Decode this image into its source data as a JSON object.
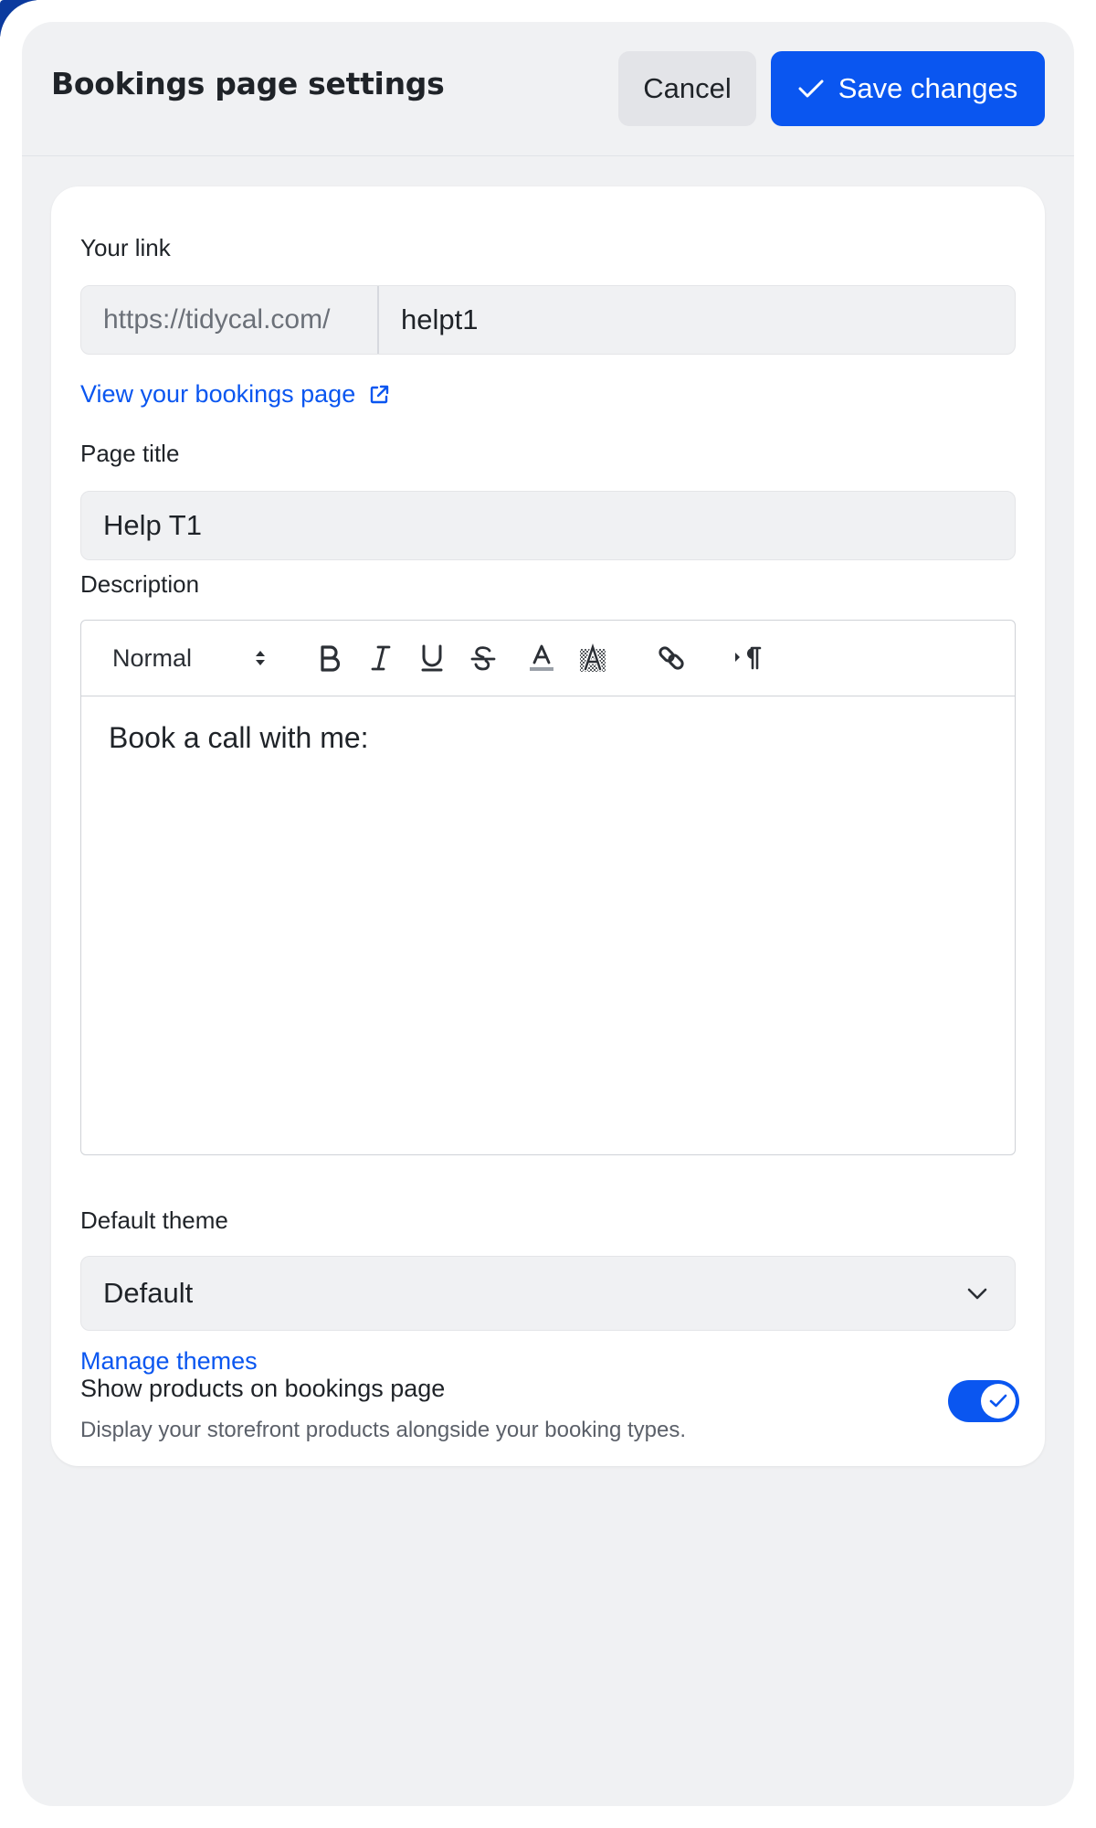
{
  "header": {
    "title": "Bookings page settings",
    "cancel_label": "Cancel",
    "save_label": "Save changes"
  },
  "link_section": {
    "label": "Your link",
    "prefix": "https://tidycal.com/",
    "value": "helpt1",
    "view_link_label": "View your bookings page"
  },
  "page_title_section": {
    "label": "Page title",
    "value": "Help T1"
  },
  "description_section": {
    "label": "Description",
    "toolbar": {
      "format_value": "Normal",
      "tools": [
        "bold-icon",
        "italic-icon",
        "underline-icon",
        "strikethrough-icon",
        "text-color-icon",
        "highlight-color-icon",
        "link-icon",
        "text-direction-icon"
      ]
    },
    "content": "Book a call with me:"
  },
  "theme_section": {
    "label": "Default theme",
    "value": "Default",
    "manage_link_label": "Manage themes"
  },
  "products_toggle": {
    "title": "Show products on bookings page",
    "description": "Display your storefront products alongside your booking types.",
    "enabled": true
  },
  "colors": {
    "accent": "#0a56f0",
    "panel_bg": "#f0f1f3",
    "card_bg": "#ffffff"
  }
}
